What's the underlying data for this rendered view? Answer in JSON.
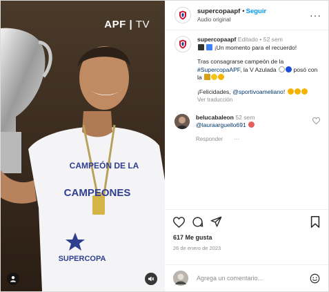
{
  "media": {
    "watermark_brand": "APF",
    "watermark_suffix": "TV",
    "shirt_line1": "CAMPEÓN DE LA",
    "shirt_line2": "CAMPEONES",
    "shirt_line3": "SUPERCOPA",
    "icons": [
      "user-tag-icon",
      "mute-icon"
    ]
  },
  "header": {
    "username": "supercopaapf",
    "separator": "•",
    "follow_label": "Seguir",
    "audio_label": "Audio original",
    "more_icon": "more-options-icon"
  },
  "caption": {
    "username": "supercopaapf",
    "edited_label": "Editado",
    "separator": "•",
    "time": "52 sem",
    "line1": "¡Un momento para el recuerdo!",
    "line2_before": "Tras consagrarse campeón de la",
    "hashtag": "#SupercopaAPF",
    "line2_after": ", la V Azulada",
    "line2_end": "posó",
    "line2_end2": "con la",
    "line3_before": "¡Felicidades,",
    "mention": "@sportivoameliano",
    "line3_after": "!",
    "translate_label": "Ver traducción"
  },
  "comment": {
    "username": "belucabaleon",
    "time": "52 sem",
    "mention": "@lauraarguello691",
    "reply_label": "Responder",
    "more_label": "···"
  },
  "actions": {
    "likes": "617 Me gusta",
    "date": "26 de enero de 2023",
    "icons": [
      "heart-icon",
      "comment-icon",
      "share-icon",
      "bookmark-icon"
    ]
  },
  "add_comment": {
    "placeholder": "Agrega un comentario...",
    "emoji_icon": "emoji-icon"
  },
  "colors": {
    "accent": "#0095f6",
    "link": "#00376b",
    "text": "#262626",
    "muted": "#8e8e8e"
  }
}
